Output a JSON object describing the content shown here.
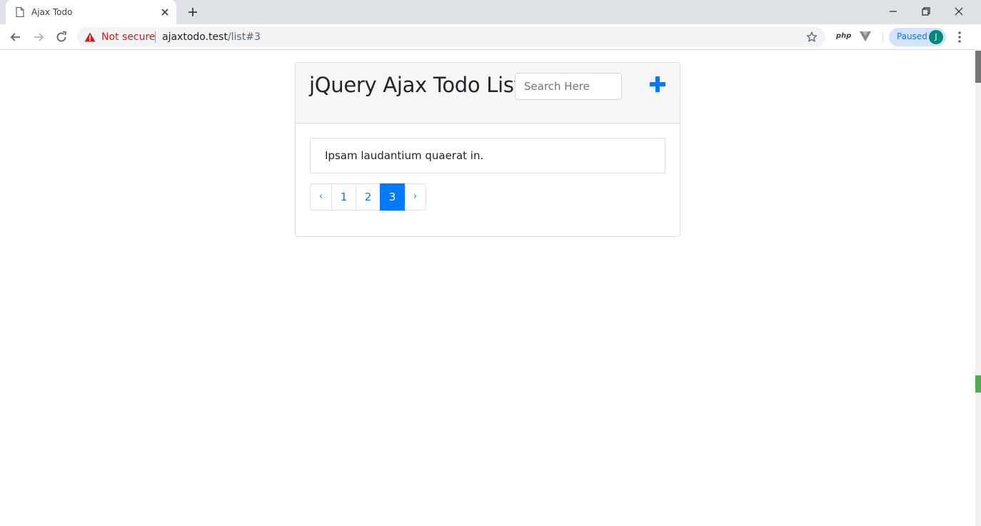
{
  "browser": {
    "tab_title": "Ajax Todo",
    "security_label": "Not secure",
    "url_host": "ajaxtodo.test",
    "url_path": "/list#3",
    "extension_php_label": "php",
    "profile_status": "Paused",
    "profile_initial": "J"
  },
  "header": {
    "title": "jQuery Ajax Todo List",
    "search_placeholder": "Search Here",
    "add_button_color": "#007bff"
  },
  "todos": [
    {
      "text": "Ipsam laudantium quaerat in."
    }
  ],
  "pagination": {
    "prev_label": "‹",
    "next_label": "›",
    "pages": [
      "1",
      "2",
      "3"
    ],
    "current_page": "3",
    "accent_color": "#007bff"
  }
}
